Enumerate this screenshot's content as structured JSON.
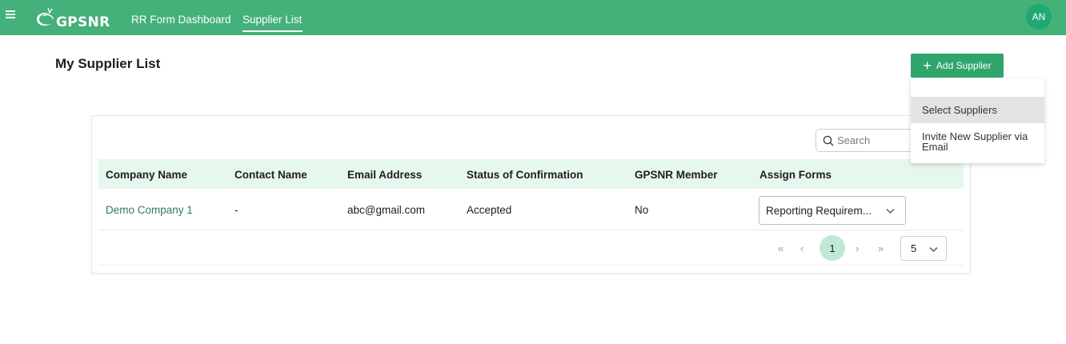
{
  "nav": {
    "logo": "GPSNR",
    "links": [
      "RR Form Dashboard",
      "Supplier List"
    ],
    "active": "Supplier List",
    "avatar": "AN"
  },
  "page": {
    "title": "My Supplier List",
    "add_button": "Add Supplier"
  },
  "dropdown": {
    "items": [
      "Select Suppliers",
      "Invite New Supplier via Email"
    ]
  },
  "search": {
    "placeholder": "Search"
  },
  "table": {
    "headers": [
      "Company Name",
      "Contact Name",
      "Email Address",
      "Status of Confirmation",
      "GPSNR Member",
      "Assign Forms"
    ],
    "rows": [
      {
        "company": "Demo Company 1",
        "contact": "-",
        "email": "abc@gmail.com",
        "status": "Accepted",
        "member": "No",
        "assign_form": "Reporting Requirem..."
      }
    ]
  },
  "pagination": {
    "current_page": "1",
    "page_size": "5"
  }
}
